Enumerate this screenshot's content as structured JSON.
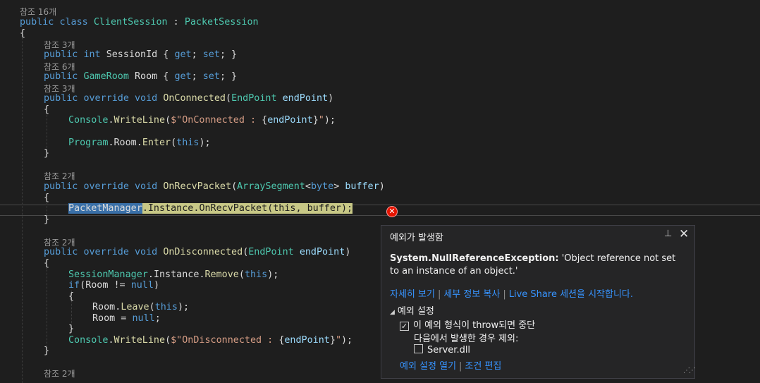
{
  "editor": {
    "ref16": "참조 16개",
    "ref3a": "참조 3개",
    "ref6": "참조 6개",
    "ref3b": "참조 3개",
    "ref2a": "참조 2개",
    "ref2b": "참조 2개",
    "ref2c": "참조 2개",
    "l_public": "public",
    "l_class": "class",
    "l_override": "override",
    "l_void": "void",
    "l_int": "int",
    "l_get": "get",
    "l_set": "set",
    "l_this": "this",
    "l_null": "null",
    "l_if": "if",
    "l_byte": "byte",
    "t_ClientSession": "ClientSession",
    "t_PacketSession": "PacketSession",
    "t_GameRoom": "GameRoom",
    "t_EndPoint": "EndPoint",
    "t_Console": "Console",
    "t_Program": "Program",
    "t_ArraySegment": "ArraySegment",
    "t_PacketManager": "PacketManager",
    "t_SessionManager": "SessionManager",
    "m_SessionId": "SessionId",
    "m_Room": "Room",
    "m_OnConnected": "OnConnected",
    "m_WriteLine": "WriteLine",
    "m_Enter": "Enter",
    "m_OnRecvPacket": "OnRecvPacket",
    "m_Instance": "Instance",
    "m_OnDisconnected": "OnDisconnected",
    "m_Remove": "Remove",
    "m_Leave": "Leave",
    "p_endPoint": "endPoint",
    "p_buffer": "buffer",
    "s_connected": "$\"OnConnected : ",
    "s_disconnected": "$\"OnDisconnected : ",
    "s_close": "\""
  },
  "popup": {
    "title": "예외가 발생함",
    "pin_icon": "pin-icon",
    "close_icon": "close-icon",
    "exception_type": "System.NullReferenceException:",
    "exception_message": " 'Object reference not set to an instance of an object.'",
    "link_details": "자세히 보기",
    "link_copy": "세부 정보 복사",
    "link_liveshare": "Live Share 세션을 시작합니다.",
    "settings_header": "예외 설정",
    "option_break": "이 예외 형식이 throw되면 중단",
    "option_except": "다음에서 발생한 경우 제외:",
    "option_server": "Server.dll",
    "link_open_settings": "예외 설정 열기",
    "link_edit_conditions": "조건 편집",
    "break_checked": true,
    "server_checked": false
  },
  "colors": {
    "background": "#1e1e1e",
    "keyword": "#569cd6",
    "type": "#4ec9b0",
    "method": "#dcdcaa",
    "string": "#d69d85",
    "link": "#3794ff",
    "error": "#e51400"
  }
}
